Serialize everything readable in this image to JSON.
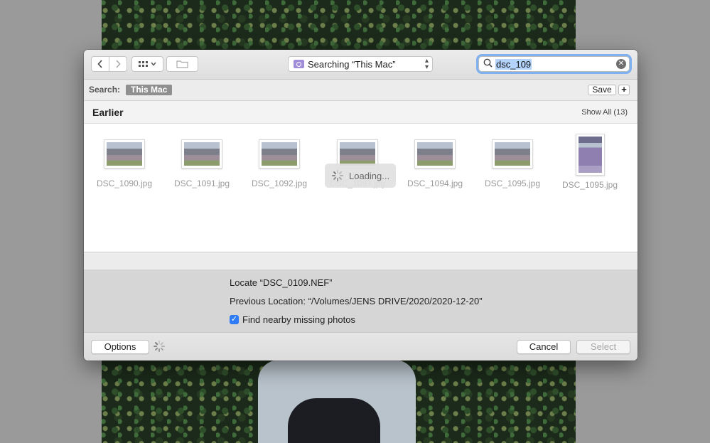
{
  "toolbar": {
    "back_icon": "chevron-left-icon",
    "forward_icon": "chevron-right-icon",
    "view_icon": "icon-grid-icon",
    "new_folder_icon": "new-folder-icon",
    "location": "Searching “This Mac”",
    "search_query": "dsc_109"
  },
  "scope_bar": {
    "label": "Search:",
    "token": "This Mac",
    "save_label": "Save",
    "add_label": "+"
  },
  "section": {
    "title": "Earlier",
    "show_all": "Show All (13)"
  },
  "results": [
    {
      "name": "DSC_1090.jpg",
      "orientation": "landscape"
    },
    {
      "name": "DSC_1091.jpg",
      "orientation": "landscape"
    },
    {
      "name": "DSC_1092.jpg",
      "orientation": "landscape"
    },
    {
      "name": "DSC_1093.jpg",
      "orientation": "landscape"
    },
    {
      "name": "DSC_1094.jpg",
      "orientation": "landscape"
    },
    {
      "name": "DSC_1095.jpg",
      "orientation": "landscape"
    },
    {
      "name": "DSC_1095.jpg",
      "orientation": "portrait"
    }
  ],
  "loading_text": "Loading...",
  "locate": {
    "title": "Locate “DSC_0109.NEF”",
    "previous_location": "Previous Location: “/Volumes/JENS DRIVE/2020/2020-12-20”",
    "find_nearby_label": "Find nearby missing photos",
    "find_nearby_checked": true
  },
  "buttons": {
    "options": "Options",
    "cancel": "Cancel",
    "select": "Select"
  },
  "colors": {
    "accent": "#2f7bf6",
    "search_focus_ring": "#7fb1f1",
    "selection_highlight": "#b3d3fb"
  }
}
